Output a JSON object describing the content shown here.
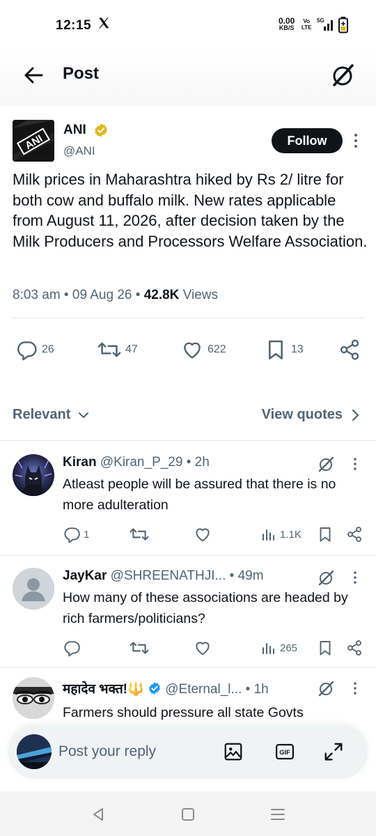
{
  "status_bar": {
    "time": "12:15",
    "net_speed": "0.00",
    "net_unit": "KB/S",
    "volte_top": "Vo",
    "volte_bottom": "LTE",
    "network": "5G"
  },
  "header": {
    "title": "Post",
    "back_icon": "arrow-left-icon",
    "grok_icon": "grok-icon"
  },
  "tweet": {
    "author_name": "ANI",
    "author_handle": "@ANI",
    "avatar_text": "ANI",
    "follow_label": "Follow",
    "text": "Milk prices in Maharashtra hiked by Rs 2/ litre for both cow and buffalo milk. New rates applicable from August 11, 2026, after decision taken by the Milk Producers and Processors Welfare Association.",
    "time": "8:03 am",
    "date": "09 Aug 26",
    "views_count": "42.8K",
    "views_label": "Views",
    "stats": {
      "replies": "26",
      "reposts": "47",
      "likes": "622",
      "bookmarks": "13"
    }
  },
  "filter": {
    "sort_label": "Relevant",
    "quotes_label": "View quotes"
  },
  "replies": [
    {
      "name": "Kiran",
      "handle": "@Kiran_P_29",
      "time": "2h",
      "text": "Atleast people will be assured that there is no more adulteration",
      "replies": "1",
      "views": "1.1K"
    },
    {
      "name": "JayKar",
      "handle": "@SHREENATHJI...",
      "time": "49m",
      "text": "How many of these associations are headed by rich farmers/politicians?",
      "replies": "",
      "views": "265"
    },
    {
      "name": "महादेव भक्त!🔱",
      "handle": "@Eternal_l...",
      "time": "1h",
      "text": "Farmers should pressure all state Govts"
    }
  ],
  "composer": {
    "placeholder": "Post your reply"
  },
  "colors": {
    "text": "#0f1419",
    "secondary": "#536471",
    "verified_gold": "#e2b719",
    "verified_blue": "#1d9bf0"
  }
}
